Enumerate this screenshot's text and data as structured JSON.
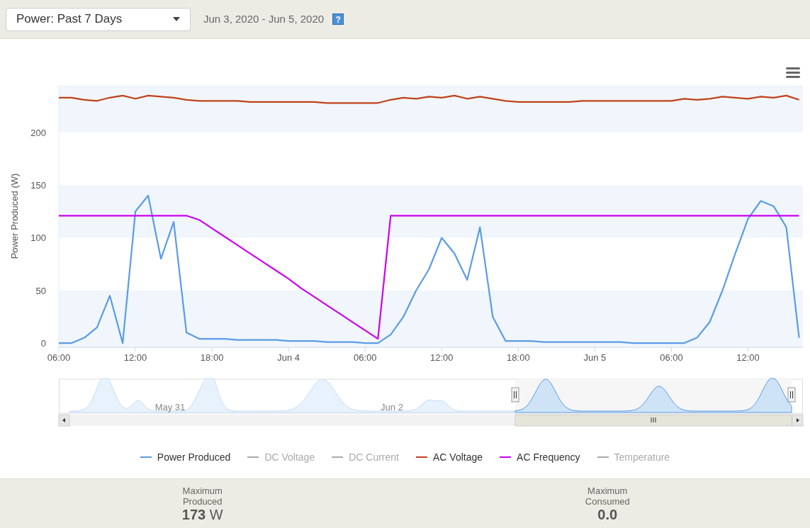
{
  "header": {
    "period_select": "Power: Past 7 Days",
    "date_range": "Jun 3, 2020 - Jun 5, 2020",
    "help_label": "?"
  },
  "chart": {
    "chart_data": {
      "type": "line",
      "ylabel": "Power Produced (W)",
      "ylim": [
        -4,
        245
      ],
      "xlim": [
        "2020-06-03T06:00",
        "2020-06-05T16:18"
      ],
      "yticks": [
        0,
        50,
        100,
        150,
        200
      ],
      "xticks": [
        {
          "value": "2020-06-03T06:00",
          "label": "06:00"
        },
        {
          "value": "2020-06-03T12:00",
          "label": "12:00"
        },
        {
          "value": "2020-06-03T18:00",
          "label": "18:00"
        },
        {
          "value": "2020-06-04T00:00",
          "label": "Jun 4"
        },
        {
          "value": "2020-06-04T06:00",
          "label": "06:00"
        },
        {
          "value": "2020-06-04T12:00",
          "label": "12:00"
        },
        {
          "value": "2020-06-04T18:00",
          "label": "18:00"
        },
        {
          "value": "2020-06-05T00:00",
          "label": "Jun 5"
        },
        {
          "value": "2020-06-05T06:00",
          "label": "06:00"
        },
        {
          "value": "2020-06-05T12:00",
          "label": "12:00"
        }
      ],
      "x": [
        "2020-06-03T06:00",
        "2020-06-03T07:00",
        "2020-06-03T08:00",
        "2020-06-03T09:00",
        "2020-06-03T10:00",
        "2020-06-03T11:00",
        "2020-06-03T12:00",
        "2020-06-03T13:00",
        "2020-06-03T14:00",
        "2020-06-03T15:00",
        "2020-06-03T16:00",
        "2020-06-03T17:00",
        "2020-06-03T18:00",
        "2020-06-03T19:00",
        "2020-06-03T20:00",
        "2020-06-03T21:00",
        "2020-06-03T22:00",
        "2020-06-03T23:00",
        "2020-06-04T00:00",
        "2020-06-04T01:00",
        "2020-06-04T02:00",
        "2020-06-04T03:00",
        "2020-06-04T04:00",
        "2020-06-04T05:00",
        "2020-06-04T06:00",
        "2020-06-04T07:00",
        "2020-06-04T08:00",
        "2020-06-04T09:00",
        "2020-06-04T10:00",
        "2020-06-04T11:00",
        "2020-06-04T12:00",
        "2020-06-04T13:00",
        "2020-06-04T14:00",
        "2020-06-04T15:00",
        "2020-06-04T16:00",
        "2020-06-04T17:00",
        "2020-06-04T18:00",
        "2020-06-04T19:00",
        "2020-06-04T20:00",
        "2020-06-04T21:00",
        "2020-06-04T22:00",
        "2020-06-04T23:00",
        "2020-06-05T00:00",
        "2020-06-05T01:00",
        "2020-06-05T02:00",
        "2020-06-05T03:00",
        "2020-06-05T04:00",
        "2020-06-05T05:00",
        "2020-06-05T06:00",
        "2020-06-05T07:00",
        "2020-06-05T08:00",
        "2020-06-05T09:00",
        "2020-06-05T10:00",
        "2020-06-05T11:00",
        "2020-06-05T12:00",
        "2020-06-05T13:00",
        "2020-06-05T14:00",
        "2020-06-05T15:00",
        "2020-06-05T16:00"
      ],
      "series": [
        {
          "name": "Power Produced",
          "color": "#5b9be8",
          "values": [
            0,
            0,
            5,
            15,
            45,
            0,
            125,
            140,
            80,
            115,
            10,
            4,
            4,
            4,
            3,
            3,
            3,
            3,
            2,
            2,
            2,
            1,
            1,
            1,
            0,
            0,
            8,
            25,
            50,
            70,
            100,
            85,
            60,
            110,
            25,
            2,
            2,
            2,
            1,
            1,
            1,
            1,
            1,
            1,
            1,
            0,
            0,
            0,
            0,
            0,
            5,
            20,
            50,
            85,
            118,
            135,
            130,
            110,
            5
          ]
        },
        {
          "name": "AC Voltage",
          "color": "#c0421b",
          "values": [
            233,
            233,
            231,
            230,
            233,
            235,
            232,
            235,
            234,
            233,
            231,
            230,
            230,
            230,
            230,
            229,
            229,
            229,
            229,
            229,
            229,
            228,
            228,
            228,
            228,
            228,
            231,
            233,
            232,
            234,
            233,
            235,
            232,
            234,
            232,
            230,
            229,
            229,
            229,
            229,
            229,
            230,
            230,
            230,
            230,
            230,
            230,
            230,
            230,
            232,
            231,
            232,
            234,
            233,
            232,
            234,
            233,
            235,
            231
          ]
        },
        {
          "name": "AC Frequency",
          "color": "#cc00ee",
          "values": [
            121,
            121,
            121,
            121,
            121,
            121,
            121,
            121,
            121,
            121,
            121,
            117,
            109,
            101,
            93,
            85,
            77,
            69,
            61,
            52,
            44,
            36,
            28,
            20,
            12,
            4,
            121,
            121,
            121,
            121,
            121,
            121,
            121,
            121,
            121,
            121,
            121,
            121,
            121,
            121,
            121,
            121,
            121,
            121,
            121,
            121,
            121,
            121,
            121,
            121,
            121,
            121,
            121,
            121,
            121,
            121,
            121,
            121,
            121
          ]
        }
      ]
    },
    "navigator_labels": [
      "May 31",
      "Jun 2"
    ],
    "legend": [
      {
        "visible": true
      },
      {
        "name": "DC Voltage",
        "visible": false
      },
      {
        "name": "DC Current",
        "visible": false
      },
      {
        "visible": true
      },
      {
        "visible": true
      },
      {
        "name": "Temperature",
        "visible": false
      }
    ]
  },
  "stats": [
    {
      "label": "Maximum Produced",
      "value": "173",
      "unit": "W"
    },
    {
      "label": "Maximum Consumed",
      "value": "0.0"
    }
  ]
}
